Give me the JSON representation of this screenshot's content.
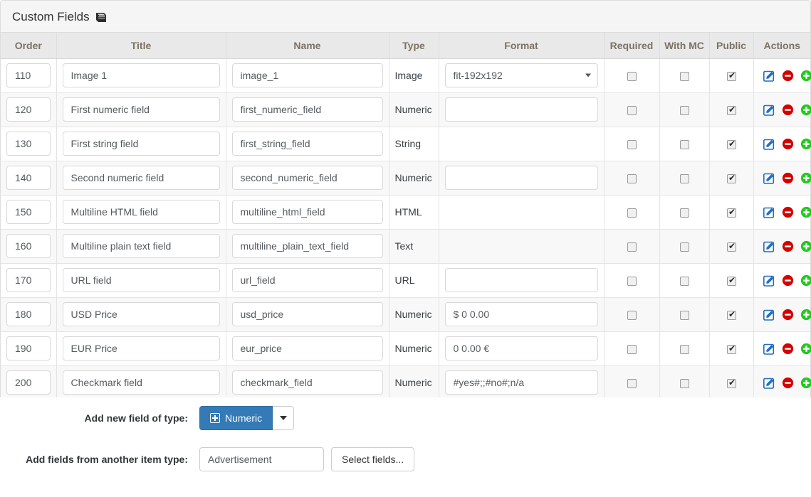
{
  "panel": {
    "title": "Custom Fields",
    "title_icon": "book-icon"
  },
  "table": {
    "headers": {
      "order": "Order",
      "title": "Title",
      "name": "Name",
      "type": "Type",
      "format": "Format",
      "required": "Required",
      "with_mc": "With MC",
      "public": "Public",
      "actions": "Actions"
    },
    "rows": [
      {
        "order": "110",
        "title": "Image 1",
        "name": "image_1",
        "type": "Image",
        "format": "fit-192x192",
        "format_control": "select",
        "required": false,
        "with_mc": false,
        "public": true
      },
      {
        "order": "120",
        "title": "First numeric field",
        "name": "first_numeric_field",
        "type": "Numeric",
        "format": "",
        "format_control": "input",
        "required": false,
        "with_mc": false,
        "public": true
      },
      {
        "order": "130",
        "title": "First string field",
        "name": "first_string_field",
        "type": "String",
        "format": "",
        "format_control": "none",
        "required": false,
        "with_mc": false,
        "public": true
      },
      {
        "order": "140",
        "title": "Second numeric field",
        "name": "second_numeric_field",
        "type": "Numeric",
        "format": "",
        "format_control": "input",
        "required": false,
        "with_mc": false,
        "public": true
      },
      {
        "order": "150",
        "title": "Multiline HTML field",
        "name": "multiline_html_field",
        "type": "HTML",
        "format": "",
        "format_control": "none",
        "required": false,
        "with_mc": false,
        "public": true
      },
      {
        "order": "160",
        "title": "Multiline plain text field",
        "name": "multiline_plain_text_field",
        "type": "Text",
        "format": "",
        "format_control": "none",
        "required": false,
        "with_mc": false,
        "public": true
      },
      {
        "order": "170",
        "title": "URL field",
        "name": "url_field",
        "type": "URL",
        "format": "",
        "format_control": "input",
        "required": false,
        "with_mc": false,
        "public": true
      },
      {
        "order": "180",
        "title": "USD Price",
        "name": "usd_price",
        "type": "Numeric",
        "format": "$ 0 0.00",
        "format_control": "input",
        "required": false,
        "with_mc": false,
        "public": true
      },
      {
        "order": "190",
        "title": "EUR Price",
        "name": "eur_price",
        "type": "Numeric",
        "format": "0 0.00 €",
        "format_control": "input",
        "required": false,
        "with_mc": false,
        "public": true
      },
      {
        "order": "200",
        "title": "Checkmark field",
        "name": "checkmark_field",
        "type": "Numeric",
        "format": "#yes#;;#no#;n/a",
        "format_control": "input",
        "required": false,
        "with_mc": false,
        "public": true
      }
    ],
    "row_actions": {
      "edit": "edit-icon",
      "remove": "remove-icon",
      "add": "add-icon"
    }
  },
  "footer": {
    "add_field_label": "Add new field of type:",
    "add_field_button": "Numeric",
    "add_from_type_label": "Add fields from another item type:",
    "item_type_value": "Advertisement",
    "select_fields_button": "Select fields..."
  },
  "colors": {
    "primary": "#337ab7",
    "edit_icon": "#1f6fc4",
    "remove_icon": "#d60000",
    "add_icon": "#22c91f",
    "header_text": "#7b7266",
    "panel_header_bg": "#f5f5f5",
    "table_header_bg": "#e9e9e9"
  }
}
